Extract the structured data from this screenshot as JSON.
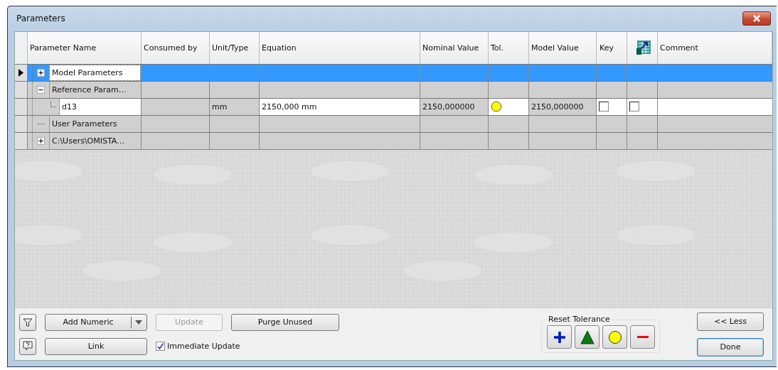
{
  "window": {
    "title": "Parameters"
  },
  "table": {
    "columns": [
      "Parameter Name",
      "Consumed by",
      "Unit/Type",
      "Equation",
      "Nominal Value",
      "Tol.",
      "Model Value",
      "Key",
      {
        "kind": "export-icon"
      },
      "Comment"
    ],
    "rows": [
      {
        "name": "Model Parameters",
        "expanded": false,
        "selected": true,
        "children": []
      },
      {
        "name": "Reference Param…",
        "expanded": true,
        "selected": false,
        "children": [
          {
            "name": "d13",
            "selected": false,
            "unit": "mm",
            "equation": "2150,000 mm",
            "nominal": "2150,000000",
            "tolerance": {
              "kind": "nominal"
            },
            "model_value": "2150,000000",
            "key": false,
            "export": false
          }
        ]
      },
      {
        "name": "User Parameters",
        "selected": false,
        "children": []
      },
      {
        "name": "C:\\Users\\OMISTA…",
        "expanded": false,
        "selected": false,
        "children": []
      }
    ]
  },
  "buttons": {
    "add_numeric": "Add Numeric",
    "update": {
      "label": "Update",
      "disabled": true
    },
    "purge": "Purge Unused",
    "link": "Link",
    "immediate_update": {
      "label": "Immediate Update",
      "checked": true
    }
  },
  "reset_tolerance": {
    "title": "Reset Tolerance",
    "buttons": [
      {
        "kind": "upper"
      },
      {
        "kind": "median"
      },
      {
        "kind": "nominal"
      },
      {
        "kind": "lower"
      }
    ]
  },
  "less_button": "<< Less",
  "done_button": "Done"
}
